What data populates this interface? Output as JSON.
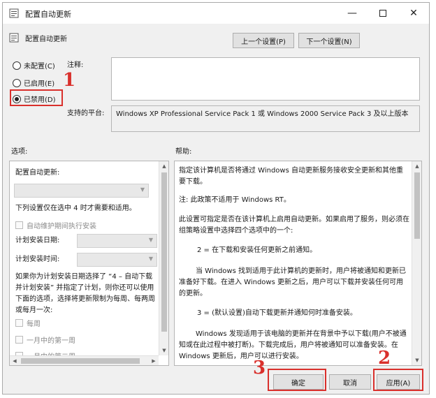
{
  "window": {
    "title": "配置自动更新"
  },
  "header": {
    "policy_name": "配置自动更新",
    "prev_label": "上一个设置(P)",
    "next_label": "下一个设置(N)"
  },
  "state": {
    "options": [
      {
        "label": "未配置(C)",
        "selected": false
      },
      {
        "label": "已启用(E)",
        "selected": false
      },
      {
        "label": "已禁用(D)",
        "selected": true
      }
    ]
  },
  "comment": {
    "label": "注释:",
    "value": ""
  },
  "platform": {
    "label": "支持的平台:",
    "value": "Windows XP Professional Service Pack 1 或 Windows 2000 Service Pack 3 及以上版本"
  },
  "options_panel": {
    "label": "选项:",
    "configure_label": "配置自动更新:",
    "note": "下列设置仅在选中 4 时才需要和适用。",
    "maintenance_checkbox": "自动维护期间执行安装",
    "schedule_day_label": "计划安装日期:",
    "schedule_time_label": "计划安装时间:",
    "description_lines": [
      "如果你为计划安装日期选择了 “4 – 自动下载",
      "并计划安装” 并指定了计划，则你还可以使用",
      "下面的选项，选择将更新限制为每周、每两周",
      "或每月一次:"
    ],
    "weekly_checkbox": "每周",
    "first_week_checkbox": "一月中的第一周",
    "second_week_checkbox": "一月中的第二周"
  },
  "help_panel": {
    "label": "帮助:",
    "paragraphs": [
      "指定该计算机是否将通过 Windows 自动更新服务接收安全更新和其他重要下载。",
      "注: 此政策不适用于 Windows RT。",
      "此设置可指定是否在该计算机上启用自动更新。如果启用了服务，则必须在组策略设置中选择四个选项中的一个:",
      "2 = 在下载和安装任何更新之前通知。",
      "当 Windows 找到适用于此计算机的更新时，用户将被通知和更新已准备好下载。在进入 Windows 更新之后，用户可以下载并安装任何可用的更新。",
      "3 = (默认设置)自动下载更新并通知何时准备安装。",
      "Windows 发现适用于该电脑的更新并在背景中予以下载(用户不被通知或在此过程中被打断)。下载完成后，用户将被通知可以准备安装。在 Windows 更新后，用户可以进行安装。"
    ]
  },
  "footer": {
    "ok_label": "确定",
    "cancel_label": "取消",
    "apply_label": "应用(A)"
  },
  "annotations": {
    "step1": "1",
    "step2": "2",
    "step3": "3"
  },
  "colors": {
    "highlight": "#d9302c",
    "button_bg": "#e1e1e1"
  },
  "icons": [
    "policy-icon",
    "minimize-icon",
    "maximize-icon",
    "close-icon"
  ]
}
